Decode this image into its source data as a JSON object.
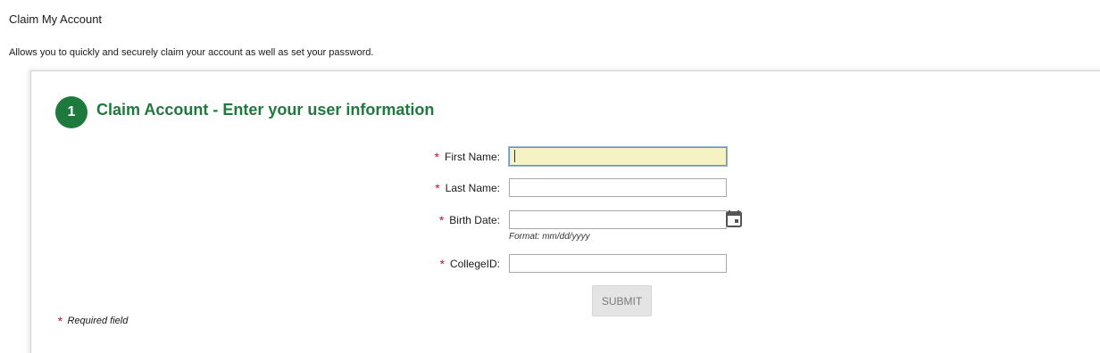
{
  "page": {
    "title": "Claim My Account",
    "description": "Allows you to quickly and securely claim your account as well as set your password."
  },
  "step": {
    "number": "1",
    "title": "Claim Account - Enter your user information"
  },
  "form": {
    "required_marker": "*",
    "fields": {
      "first_name": {
        "label": "First Name:",
        "value": ""
      },
      "last_name": {
        "label": "Last Name:",
        "value": ""
      },
      "birth_date": {
        "label": "Birth Date:",
        "value": "",
        "hint": "Format: mm/dd/yyyy",
        "icon": "calendar-icon"
      },
      "college_id": {
        "label": "CollegeID:",
        "value": ""
      }
    },
    "submit_label": "SUBMIT",
    "required_note": "Required field"
  },
  "colors": {
    "accent_green": "#1e7a3c",
    "required_red": "#c8102e",
    "focused_field_bg": "#f5f2c4"
  }
}
